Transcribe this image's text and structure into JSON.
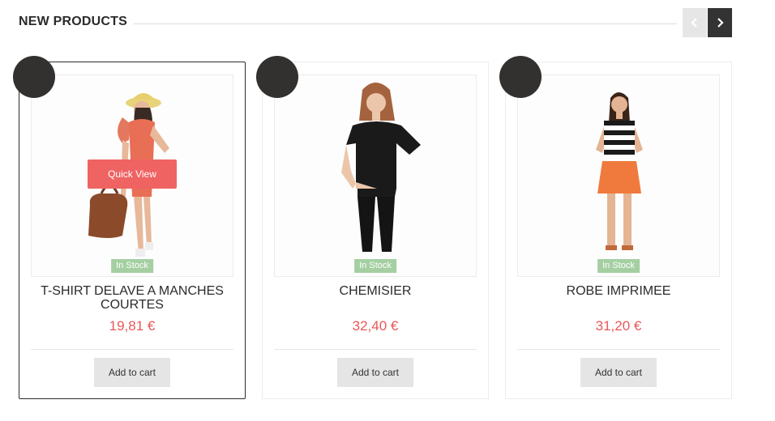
{
  "section": {
    "title": "NEW PRODUCTS",
    "prev_icon": "chevron-left-icon",
    "next_icon": "chevron-right-icon"
  },
  "colors": {
    "price": "#ea5757",
    "quick_view": "#ef6363",
    "in_stock": "#a5cfa2",
    "badge": "#333030",
    "next_button": "#333333"
  },
  "products": [
    {
      "name": "T-SHIRT DELAVE A MANCHES COURTES",
      "price": "19,81 €",
      "stock": "In Stock",
      "quick_view": "Quick View",
      "add_to_cart": "Add to cart"
    },
    {
      "name": "CHEMISIER",
      "price": "32,40 €",
      "stock": "In Stock",
      "add_to_cart": "Add to cart"
    },
    {
      "name": "ROBE IMPRIMEE",
      "price": "31,20 €",
      "stock": "In Stock",
      "add_to_cart": "Add to cart"
    }
  ]
}
